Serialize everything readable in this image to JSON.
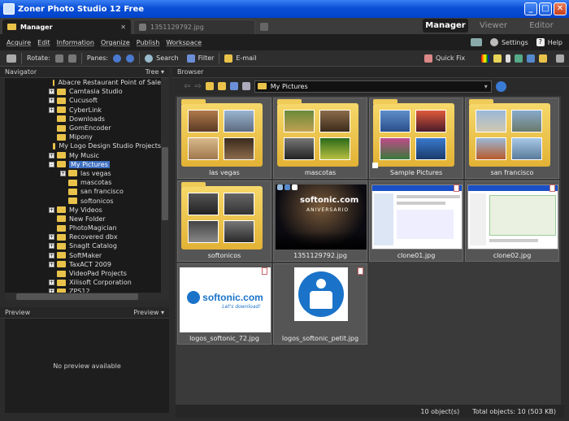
{
  "window": {
    "title": "Zoner Photo Studio 12 Free",
    "min": "_",
    "max": "□",
    "close": "✕"
  },
  "doc_tabs": [
    {
      "label": "Manager"
    },
    {
      "label": "1351129792.jpg"
    }
  ],
  "mode_tabs": [
    {
      "label": "Manager"
    },
    {
      "label": "Viewer"
    },
    {
      "label": "Editor"
    }
  ],
  "menu": [
    "Acquire",
    "Edit",
    "Information",
    "Organize",
    "Publish",
    "Workspace"
  ],
  "menu_right": {
    "settings": "Settings",
    "help": "Help"
  },
  "toolbar": {
    "rotate": "Rotate:",
    "panes": "Panes:",
    "search": "Search",
    "filter": "Filter",
    "email": "E-mail",
    "quickfix": "Quick Fix"
  },
  "navigator": {
    "title": "Navigator",
    "mode": "Tree",
    "items": [
      {
        "label": "Abacre Restaurant Point of Sale",
        "level": 0,
        "expand": ""
      },
      {
        "label": "Camtasia Studio",
        "level": 0,
        "expand": "+"
      },
      {
        "label": "Cucusoft",
        "level": 0,
        "expand": "+"
      },
      {
        "label": "CyberLink",
        "level": 0,
        "expand": "+"
      },
      {
        "label": "Downloads",
        "level": 0,
        "expand": ""
      },
      {
        "label": "GomEncoder",
        "level": 0,
        "expand": ""
      },
      {
        "label": "Mipony",
        "level": 0,
        "expand": ""
      },
      {
        "label": "My Logo Design Studio Projects",
        "level": 0,
        "expand": ""
      },
      {
        "label": "My Music",
        "level": 0,
        "expand": "+"
      },
      {
        "label": "My Pictures",
        "level": 0,
        "expand": "-",
        "selected": true
      },
      {
        "label": "las vegas",
        "level": 1,
        "expand": "+"
      },
      {
        "label": "mascotas",
        "level": 1,
        "expand": ""
      },
      {
        "label": "san francisco",
        "level": 1,
        "expand": ""
      },
      {
        "label": "softonicos",
        "level": 1,
        "expand": ""
      },
      {
        "label": "My Videos",
        "level": 0,
        "expand": "+"
      },
      {
        "label": "New Folder",
        "level": 0,
        "expand": ""
      },
      {
        "label": "PhotoMagician",
        "level": 0,
        "expand": ""
      },
      {
        "label": "Recovered dbx",
        "level": 0,
        "expand": "+"
      },
      {
        "label": "SnagIt Catalog",
        "level": 0,
        "expand": "+"
      },
      {
        "label": "SoftMaker",
        "level": 0,
        "expand": "+"
      },
      {
        "label": "TaxACT 2009",
        "level": 0,
        "expand": "+"
      },
      {
        "label": "VideoPad Projects",
        "level": 0,
        "expand": ""
      },
      {
        "label": "Xilisoft Corporation",
        "level": 0,
        "expand": "+"
      },
      {
        "label": "ZPS12",
        "level": 0,
        "expand": "+"
      }
    ]
  },
  "preview": {
    "title": "Preview",
    "mode": "Preview",
    "empty": "No preview available"
  },
  "browser": {
    "title": "Browser",
    "path": "My Pictures",
    "items": [
      {
        "name": "las vegas",
        "kind": "folder"
      },
      {
        "name": "mascotas",
        "kind": "folder"
      },
      {
        "name": "Sample Pictures",
        "kind": "folder"
      },
      {
        "name": "san francisco",
        "kind": "folder"
      },
      {
        "name": "softonicos",
        "kind": "folder"
      },
      {
        "name": "1351129792.jpg",
        "kind": "image"
      },
      {
        "name": "clone01.jpg",
        "kind": "image"
      },
      {
        "name": "clone02.jpg",
        "kind": "image"
      },
      {
        "name": "logos_softonic_72.jpg",
        "kind": "image"
      },
      {
        "name": "logos_softonic_petit.jpg",
        "kind": "image"
      }
    ],
    "thumb_texts": {
      "softonic_logo": "softonic.com",
      "softonic_tagline": "Let's download!",
      "stage_text": "softonic.com",
      "stage_sub": "ANIVERSARIO"
    }
  },
  "status": {
    "count": "10 object(s)",
    "total": "Total objects: 10 (503 KB)"
  },
  "colors": {
    "accent": "#3d6fbf",
    "folder": "#e9c24a",
    "brand": "#1a73c8"
  }
}
